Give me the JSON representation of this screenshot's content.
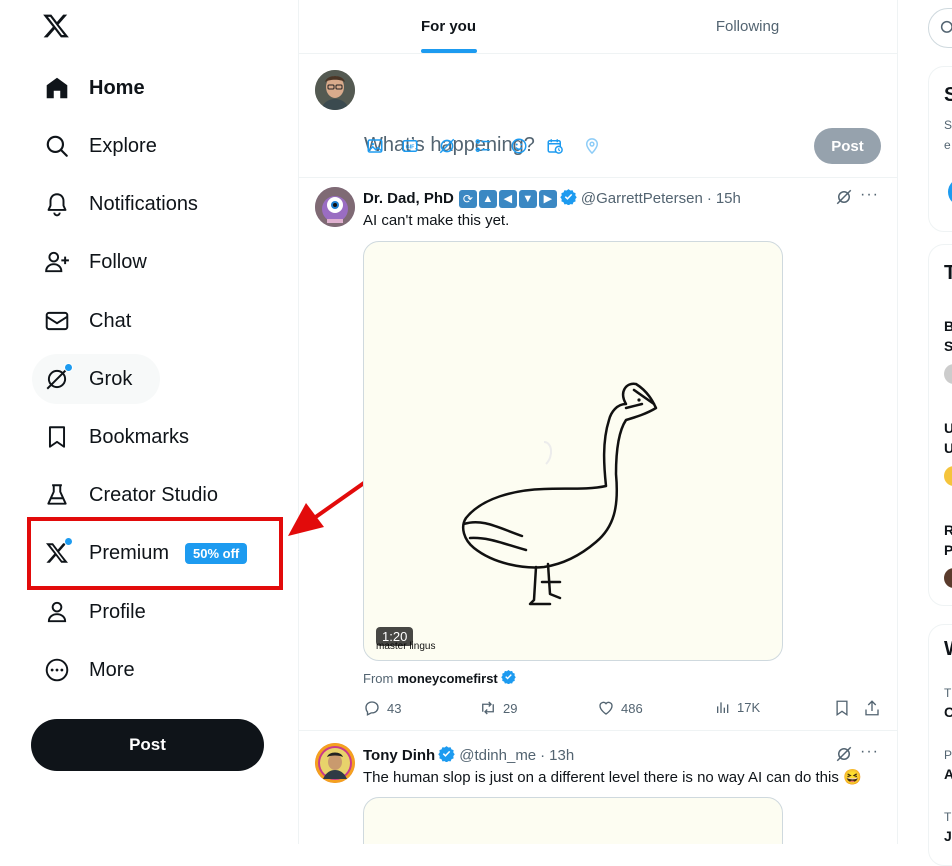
{
  "sidebar": {
    "logo_icon": "x-logo-icon",
    "items": [
      {
        "label": "Home",
        "icon": "home-icon"
      },
      {
        "label": "Explore",
        "icon": "search-icon"
      },
      {
        "label": "Notifications",
        "icon": "bell-icon"
      },
      {
        "label": "Follow",
        "icon": "person-add-icon"
      },
      {
        "label": "Chat",
        "icon": "envelope-icon"
      },
      {
        "label": "Grok",
        "icon": "grok-icon"
      },
      {
        "label": "Bookmarks",
        "icon": "bookmark-icon"
      },
      {
        "label": "Creator Studio",
        "icon": "flask-icon"
      },
      {
        "label": "Premium",
        "icon": "x-logo-icon",
        "badge": "50% off"
      },
      {
        "label": "Profile",
        "icon": "person-icon"
      },
      {
        "label": "More",
        "icon": "more-circle-icon"
      }
    ],
    "post_label": "Post"
  },
  "main": {
    "tabs": [
      {
        "label": "For you"
      },
      {
        "label": "Following"
      }
    ],
    "compose": {
      "placeholder": "What’s happening?",
      "post_label": "Post"
    },
    "tweets": [
      {
        "name": "Dr. Dad, PhD",
        "handle": "@GarrettPetersen",
        "time": "15h",
        "text": "AI can't make this yet.",
        "video_duration": "1:20",
        "video_caption": "master lingus",
        "from_label": "From",
        "from_account": "moneycomefirst",
        "replies": "43",
        "reposts": "29",
        "likes": "486",
        "views": "17K"
      },
      {
        "name": "Tony Dinh",
        "handle": "@tdinh_me",
        "time": "13h",
        "text": "The human slop is just on a different level there is no way AI can do this 😆"
      }
    ]
  },
  "right_column": {
    "partial_texts": [
      "S",
      "S",
      "e",
      "T",
      "B",
      "S",
      "U",
      "U",
      "R",
      "P",
      "W",
      "T",
      "C",
      "P",
      "A",
      "T",
      "J"
    ]
  },
  "colors": {
    "accent": "#1d9bf0",
    "annotation_red": "#e20b0b",
    "text_primary": "#0f1419",
    "text_secondary": "#536471"
  }
}
